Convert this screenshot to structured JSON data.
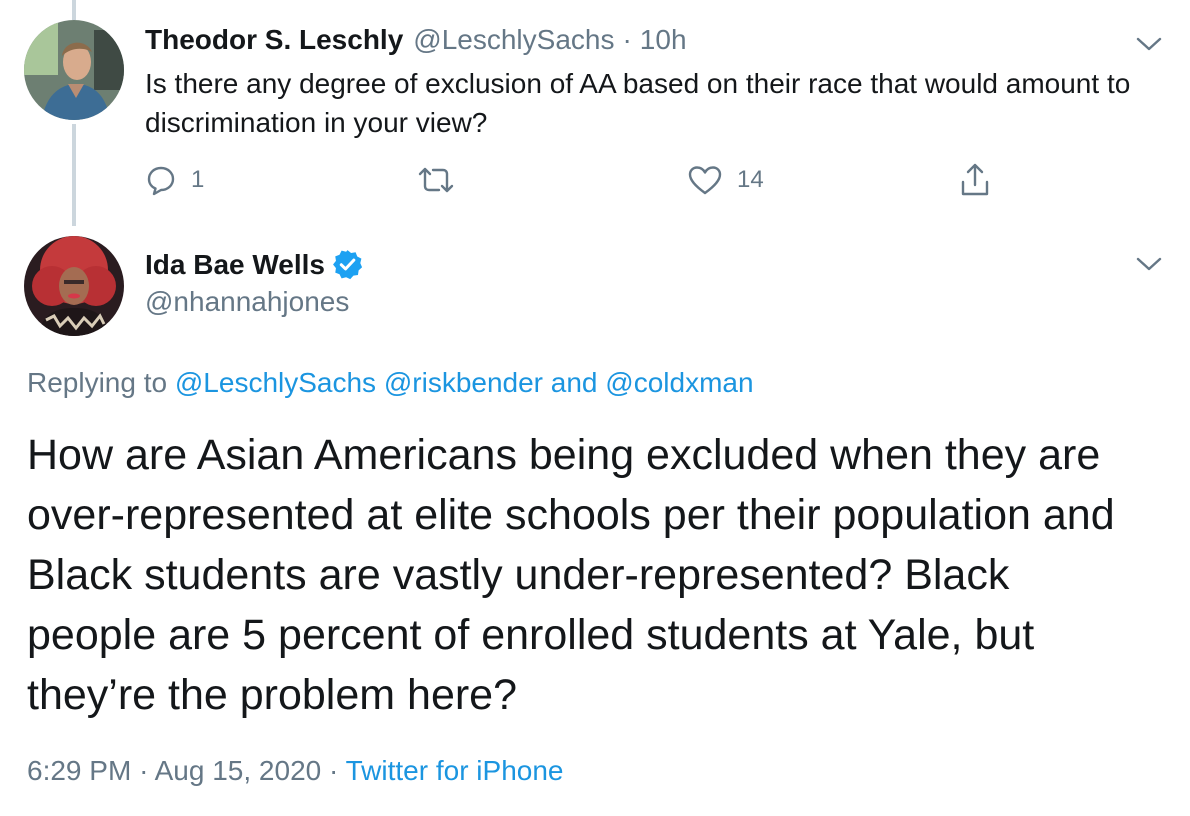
{
  "tweet1": {
    "display_name": "Theodor S. Leschly",
    "handle": "@LeschlySachs",
    "separator": "·",
    "time": "10h",
    "text": "Is there any degree of exclusion of AA based on their race that would amount to discrimination in your view?",
    "actions": {
      "reply_count": "1",
      "retweet_count": "",
      "like_count": "14"
    },
    "icons": [
      "reply-icon",
      "retweet-icon",
      "like-icon",
      "share-icon",
      "chevron-down-icon"
    ]
  },
  "tweet2": {
    "display_name": "Ida Bae Wells",
    "handle": "@nhannahjones",
    "verified": true,
    "replying_prefix": "Replying to",
    "mention1": "@LeschlySachs",
    "mention2": "@riskbender",
    "mention_joiner": "and",
    "mention3": "@coldxman",
    "text": "How are Asian Americans being excluded when they are over-represented at elite schools per their population and Black students are vastly under-represented? Black people are 5 percent of enrolled students at Yale, but they’re the problem here?",
    "time": "6:29 PM",
    "separator": "·",
    "date": "Aug 15, 2020",
    "source": "Twitter for iPhone",
    "icons": [
      "verified-icon",
      "chevron-down-icon"
    ]
  },
  "colors": {
    "text": "#14171a",
    "secondary": "#657786",
    "link": "#1b95e0",
    "thread_line": "#ccd6dd",
    "verified": "#1da1f2"
  }
}
